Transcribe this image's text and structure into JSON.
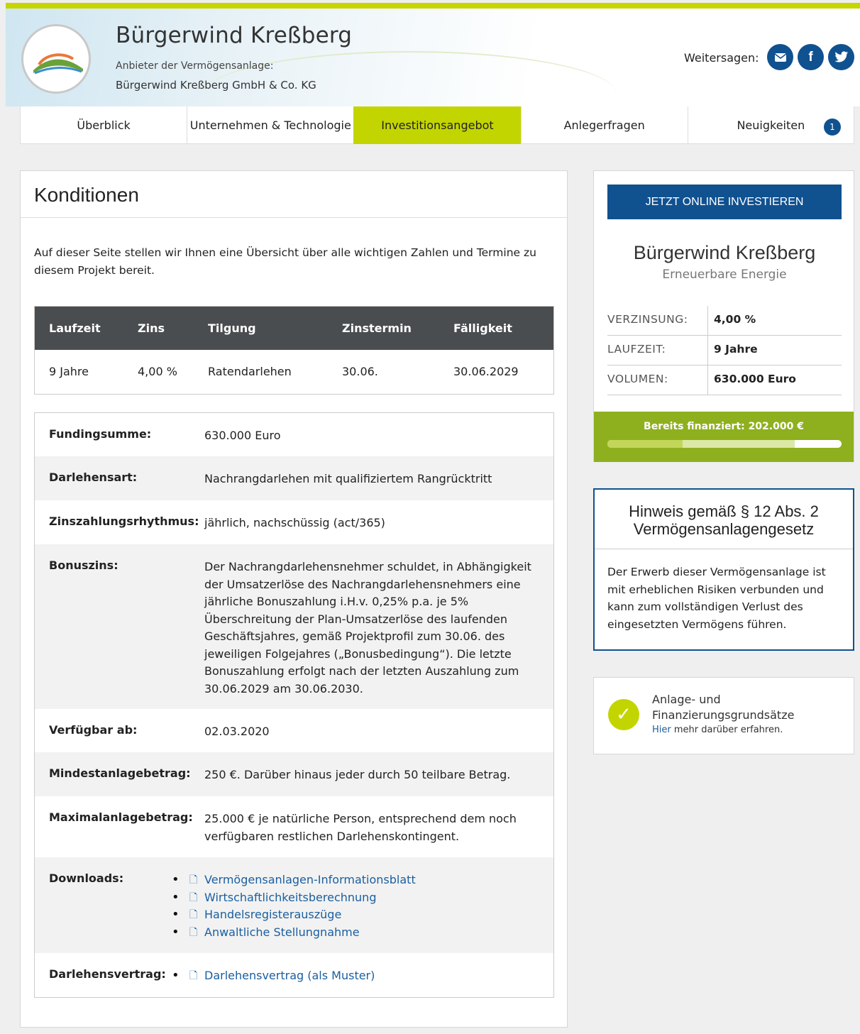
{
  "header": {
    "title": "Bürgerwind Kreßberg",
    "provider_label": "Anbieter der Vermögensanlage:",
    "provider_name": "Bürgerwind Kreßberg GmbH & Co. KG",
    "share_label": "Weitersagen:",
    "social": [
      "mail-icon",
      "facebook-icon",
      "twitter-icon"
    ]
  },
  "nav": {
    "tabs": [
      {
        "label": "Überblick"
      },
      {
        "label": "Unternehmen & Technologie"
      },
      {
        "label": "Investitionsangebot",
        "active": true
      },
      {
        "label": "Anlegerfragen"
      },
      {
        "label": "Neuigkeiten",
        "badge": "1"
      }
    ]
  },
  "main": {
    "title": "Konditionen",
    "intro": "Auf dieser Seite stellen wir Ihnen eine Übersicht über alle wichtigen Zahlen und Termine zu diesem Projekt bereit.",
    "conditions": {
      "headers": [
        "Laufzeit",
        "Zins",
        "Tilgung",
        "Zinstermin",
        "Fälligkeit"
      ],
      "values": [
        "9 Jahre",
        "4,00 %",
        "Ratendarlehen",
        "30.06.",
        "30.06.2029"
      ]
    },
    "details": [
      {
        "label": "Fundingsumme:",
        "value": "630.000 Euro"
      },
      {
        "label": "Darlehensart:",
        "value": "Nachrangdarlehen mit qualifiziertem Rangrücktritt"
      },
      {
        "label": "Zinszahlungsrhythmus:",
        "value": "jährlich, nachschüssig (act/365)"
      },
      {
        "label": "Bonuszins:",
        "value": "Der Nachrangdarlehensnehmer schuldet, in Abhängigkeit der Umsatzerlöse des Nachrangdarlehensnehmers eine jährliche Bonuszahlung i.H.v. 0,25% p.a. je 5% Überschreitung der Plan-Umsatzerlöse des laufenden Geschäftsjahres, gemäß Projektprofil zum 30.06. des jeweiligen Folgejahres („Bonusbedingung“). Die letzte Bonuszahlung erfolgt nach der letzten Auszahlung zum 30.06.2029 am 30.06.2030."
      },
      {
        "label": "Verfügbar ab:",
        "value": "02.03.2020"
      },
      {
        "label": "Mindestanlagebetrag:",
        "value": "250 €. Darüber hinaus jeder durch 50 teilbare Betrag."
      },
      {
        "label": "Maximalanlagebetrag:",
        "value": "25.000 € je natürliche Person, entsprechend dem noch verfügbaren restlichen Darlehenskontingent."
      },
      {
        "label": "Downloads:",
        "links": [
          "Vermögensanlagen-Informationsblatt",
          "Wirtschaftlichkeitsberechnung",
          "Handelsregisterauszüge",
          "Anwaltliche Stellungnahme"
        ]
      },
      {
        "label": "Darlehensvertrag:",
        "links": [
          "Darlehensvertrag (als Muster)"
        ]
      }
    ]
  },
  "sidebar": {
    "invest_button": "JETZT ONLINE INVESTIEREN",
    "project_name": "Bürgerwind Kreßberg",
    "project_category": "Erneuerbare Energie",
    "facts": [
      {
        "key": "VERZINSUNG:",
        "value": "4,00 %"
      },
      {
        "key": "LAUFZEIT:",
        "value": "9 Jahre"
      },
      {
        "key": "VOLUMEN:",
        "value": "630.000 Euro"
      }
    ],
    "funded_label": "Bereits finanziert: 202.000 €",
    "funded_fraction": 0.32,
    "funded_fraction_pending": 0.8,
    "notice_title": "Hinweis gemäß § 12 Abs. 2 Vermögensanlagengesetz",
    "notice_text": "Der Erwerb dieser Vermögensanlage ist mit erheblichen Risiken verbunden und kann zum vollständigen Verlust des eingesetzten Vermögens führen.",
    "principles_line1": "Anlage- und",
    "principles_line2": "Finanzierungsgrundsätze",
    "principles_link": "Hier",
    "principles_rest": " mehr darüber erfahren."
  },
  "colors": {
    "brand_blue": "#105190",
    "accent_green": "#c3d500",
    "funding_green": "#8fb01e",
    "table_header": "#4a4d4f"
  }
}
